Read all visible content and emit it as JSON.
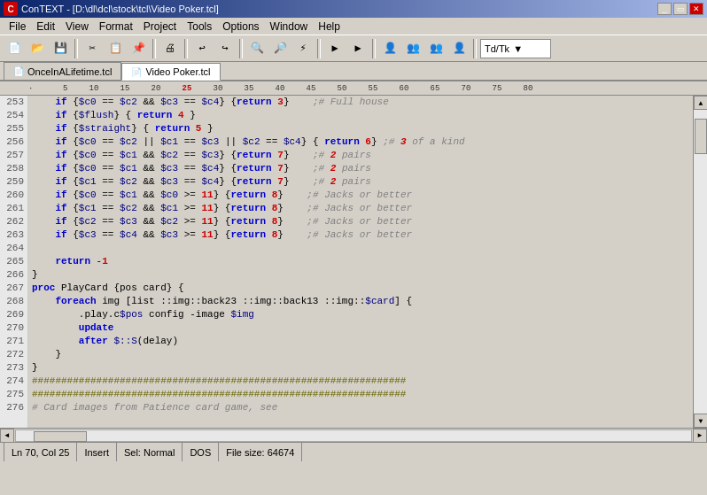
{
  "window": {
    "title": "ConTEXT - [D:\\dl\\dcl\\stock\\tcl\\Video Poker.tcl]",
    "title_icon": "C"
  },
  "menu": {
    "items": [
      "File",
      "Edit",
      "View",
      "Format",
      "Project",
      "Tools",
      "Options",
      "Window",
      "Help"
    ]
  },
  "toolbar": {
    "dropdown_label": "Td/Tk"
  },
  "tabs": [
    {
      "label": "OnceInALifetime.tcl",
      "active": false
    },
    {
      "label": "Video Poker.tcl",
      "active": true
    }
  ],
  "ruler": {
    "marks": [
      "5",
      "10",
      "15",
      "20",
      "25",
      "30",
      "35",
      "40",
      "45",
      "50",
      "55",
      "60",
      "65",
      "70",
      "75",
      "80"
    ]
  },
  "code": {
    "lines": [
      {
        "num": "253",
        "content": "    if {$c0 == $c2 && $c3 == $c4} {return 3}    ;# Full house"
      },
      {
        "num": "254",
        "content": "    if {$flush} { return 4 }"
      },
      {
        "num": "255",
        "content": "    if {$straight} { return 5 }"
      },
      {
        "num": "256",
        "content": "    if {$c0 == $c2 || $c1 == $c3 || $c2 == $c4} { return 6} ;# 3 of a kind"
      },
      {
        "num": "257",
        "content": "    if {$c0 == $c1 && $c2 == $c3} {return 7}    ;# 2 pairs"
      },
      {
        "num": "258",
        "content": "    if {$c0 == $c1 && $c3 == $c4} {return 7}    ;# 2 pairs"
      },
      {
        "num": "259",
        "content": "    if {$c1 == $c2 && $c3 == $c4} {return 7}    ;# 2 pairs"
      },
      {
        "num": "260",
        "content": "    if {$c0 == $c1 && $c0 >= 11} {return 8}    ;# Jacks or better"
      },
      {
        "num": "261",
        "content": "    if {$c1 == $c2 && $c1 >= 11} {return 8}    ;# Jacks or better"
      },
      {
        "num": "262",
        "content": "    if {$c2 == $c3 && $c2 >= 11} {return 8}    ;# Jacks or better"
      },
      {
        "num": "263",
        "content": "    if {$c3 == $c4 && $c3 >= 11} {return 8}    ;# Jacks or better"
      },
      {
        "num": "264",
        "content": ""
      },
      {
        "num": "265",
        "content": "    return -1"
      },
      {
        "num": "266",
        "content": "}"
      },
      {
        "num": "267",
        "content": "proc PlayCard {pos card} {"
      },
      {
        "num": "268",
        "content": "    foreach img [list ::img::back23 ::img::back13 ::img::$card] {"
      },
      {
        "num": "269",
        "content": "        .play.c$pos config -image $img"
      },
      {
        "num": "270",
        "content": "        update"
      },
      {
        "num": "271",
        "content": "        after $::S(delay)"
      },
      {
        "num": "272",
        "content": "    }"
      },
      {
        "num": "273",
        "content": "}"
      },
      {
        "num": "274",
        "content": "################################################################"
      },
      {
        "num": "275",
        "content": "################################################################"
      },
      {
        "num": "276",
        "content": "# Card images from Patience card game, see"
      }
    ]
  },
  "status": {
    "position": "Ln 70, Col 25",
    "mode": "Insert",
    "selection": "Sel: Normal",
    "line_ending": "DOS",
    "file_size": "File size: 64674"
  }
}
